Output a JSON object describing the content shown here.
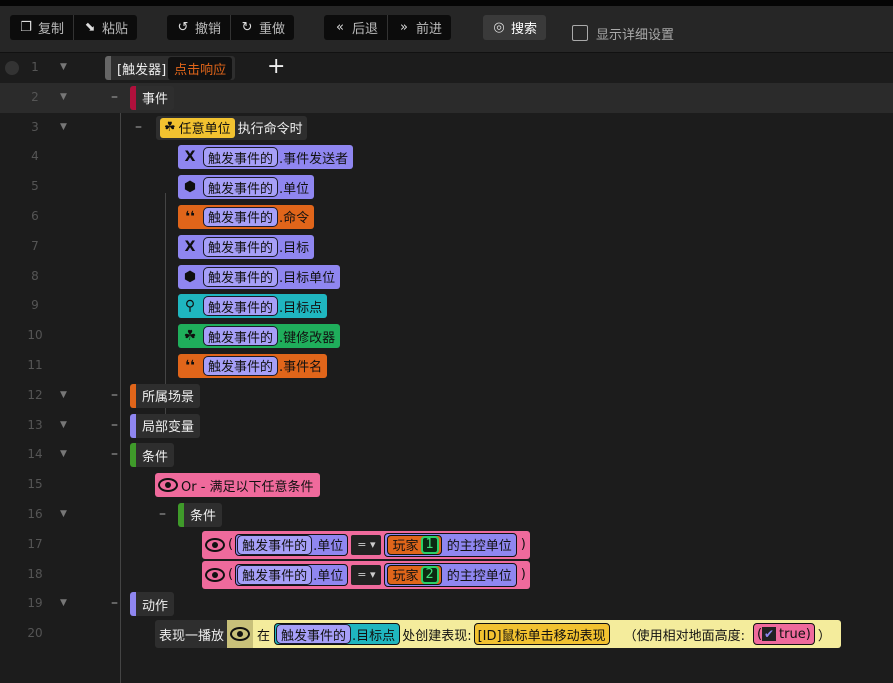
{
  "toolbar": {
    "copy": "复制",
    "paste": "粘贴",
    "undo": "撤销",
    "redo": "重做",
    "back": "后退",
    "forward": "前进",
    "search": "搜索",
    "detail": "显示详细设置"
  },
  "rows": {
    "r1": {
      "n": "1",
      "prefix": "[触发器]",
      "name": "点击响应"
    },
    "r2": {
      "n": "2",
      "label": "事件"
    },
    "r3": {
      "n": "3",
      "unit": "任意单位",
      "event": "执行命令时"
    },
    "params": [
      {
        "n": "4",
        "pill": "触发事件的",
        "suffix": ".事件发送者",
        "icon": "X"
      },
      {
        "n": "5",
        "pill": "触发事件的",
        "suffix": ".单位",
        "icon": "⬢"
      },
      {
        "n": "6",
        "pill": "触发事件的",
        "suffix": ".命令",
        "icon": "❛❛"
      },
      {
        "n": "7",
        "pill": "触发事件的",
        "suffix": ".目标",
        "icon": "X"
      },
      {
        "n": "8",
        "pill": "触发事件的",
        "suffix": ".目标单位",
        "icon": "⬢"
      },
      {
        "n": "9",
        "pill": "触发事件的",
        "suffix": ".目标点",
        "icon": "⚲"
      },
      {
        "n": "10",
        "pill": "触发事件的",
        "suffix": ".键修改器",
        "icon": "☘"
      },
      {
        "n": "11",
        "pill": "触发事件的",
        "suffix": ".事件名",
        "icon": "❛❛"
      }
    ],
    "r12": {
      "n": "12",
      "label": "所属场景"
    },
    "r13": {
      "n": "13",
      "label": "局部变量"
    },
    "r14": {
      "n": "14",
      "label": "条件"
    },
    "r15": {
      "n": "15",
      "label": "Or - 满足以下任意条件"
    },
    "r16": {
      "n": "16",
      "label": "条件"
    },
    "cmp": [
      {
        "n": "17",
        "open": "(",
        "pill": "触发事件的",
        "suffix": ".单位",
        "op": "= ▾",
        "player": "玩家",
        "num": "1",
        "tail": "的主控单位",
        "close": ")"
      },
      {
        "n": "18",
        "open": "(",
        "pill": "触发事件的",
        "suffix": ".单位",
        "op": "= ▾",
        "player": "玩家",
        "num": "2",
        "tail": "的主控单位",
        "close": ")"
      }
    ],
    "r19": {
      "n": "19",
      "label": "动作"
    },
    "r20": {
      "n": "20",
      "action": "表现一播放",
      "at": "在",
      "pill": "触发事件的",
      "suffix": ".目标点",
      "create": "处创建表现:",
      "effect": "[ID]鼠标单击移动表现",
      "opt": "（使用相对地面高度:",
      "val": "true)",
      "open": "(",
      "close": "）"
    }
  }
}
